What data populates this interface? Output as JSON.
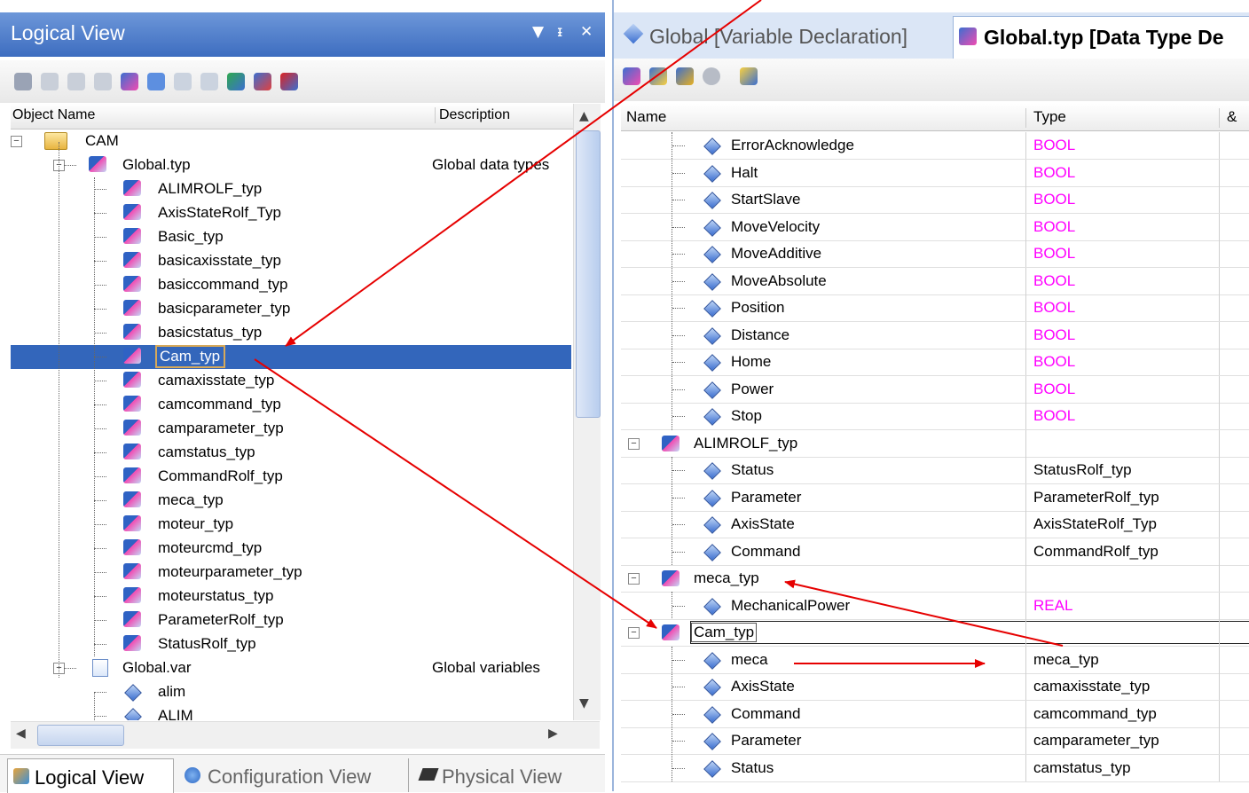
{
  "left_panel": {
    "title": "Logical View",
    "title_controls": [
      "▼",
      "ᵻ",
      "✕"
    ],
    "columns": {
      "object_name": "Object Name",
      "description": "Description"
    },
    "tree": [
      {
        "label": "CAM",
        "desc": "",
        "level": 0,
        "icon": "folder-icon"
      },
      {
        "label": "Global.typ",
        "desc": "Global data types",
        "level": 1,
        "icon": "datatype-icon"
      },
      {
        "label": "ALIMROLF_typ",
        "desc": "",
        "level": 2,
        "icon": "datatype-icon"
      },
      {
        "label": "AxisStateRolf_Typ",
        "desc": "",
        "level": 2,
        "icon": "datatype-icon"
      },
      {
        "label": "Basic_typ",
        "desc": "",
        "level": 2,
        "icon": "datatype-icon"
      },
      {
        "label": "basicaxisstate_typ",
        "desc": "",
        "level": 2,
        "icon": "datatype-icon"
      },
      {
        "label": "basiccommand_typ",
        "desc": "",
        "level": 2,
        "icon": "datatype-icon"
      },
      {
        "label": "basicparameter_typ",
        "desc": "",
        "level": 2,
        "icon": "datatype-icon"
      },
      {
        "label": "basicstatus_typ",
        "desc": "",
        "level": 2,
        "icon": "datatype-icon"
      },
      {
        "label": "Cam_typ",
        "desc": "",
        "level": 2,
        "icon": "datatype-icon",
        "selected": true
      },
      {
        "label": "camaxisstate_typ",
        "desc": "",
        "level": 2,
        "icon": "datatype-icon"
      },
      {
        "label": "camcommand_typ",
        "desc": "",
        "level": 2,
        "icon": "datatype-icon"
      },
      {
        "label": "camparameter_typ",
        "desc": "",
        "level": 2,
        "icon": "datatype-icon"
      },
      {
        "label": "camstatus_typ",
        "desc": "",
        "level": 2,
        "icon": "datatype-icon"
      },
      {
        "label": "CommandRolf_typ",
        "desc": "",
        "level": 2,
        "icon": "datatype-icon"
      },
      {
        "label": "meca_typ",
        "desc": "",
        "level": 2,
        "icon": "datatype-icon"
      },
      {
        "label": "moteur_typ",
        "desc": "",
        "level": 2,
        "icon": "datatype-icon"
      },
      {
        "label": "moteurcmd_typ",
        "desc": "",
        "level": 2,
        "icon": "datatype-icon"
      },
      {
        "label": "moteurparameter_typ",
        "desc": "",
        "level": 2,
        "icon": "datatype-icon"
      },
      {
        "label": "moteurstatus_typ",
        "desc": "",
        "level": 2,
        "icon": "datatype-icon"
      },
      {
        "label": "ParameterRolf_typ",
        "desc": "",
        "level": 2,
        "icon": "datatype-icon"
      },
      {
        "label": "StatusRolf_typ",
        "desc": "",
        "level": 2,
        "icon": "datatype-icon"
      },
      {
        "label": "Global.var",
        "desc": "Global variables",
        "level": 1,
        "icon": "variable-file-icon"
      },
      {
        "label": "alim",
        "desc": "",
        "level": 2,
        "icon": "variable-icon"
      },
      {
        "label": "ALIM",
        "desc": "",
        "level": 2,
        "icon": "variable-icon"
      }
    ],
    "bottom_tabs": [
      "Logical View",
      "Configuration View",
      "Physical View"
    ]
  },
  "right_panel": {
    "tabs": [
      "Global [Variable Declaration]",
      "Global.typ [Data Type De"
    ],
    "columns": {
      "name": "Name",
      "type": "Type",
      "extra": "&"
    },
    "rows": [
      {
        "name": "ErrorAcknowledge",
        "type": "BOOL",
        "kind": "member",
        "pink": true
      },
      {
        "name": "Halt",
        "type": "BOOL",
        "kind": "member",
        "pink": true
      },
      {
        "name": "StartSlave",
        "type": "BOOL",
        "kind": "member",
        "pink": true
      },
      {
        "name": "MoveVelocity",
        "type": "BOOL",
        "kind": "member",
        "pink": true
      },
      {
        "name": "MoveAdditive",
        "type": "BOOL",
        "kind": "member",
        "pink": true
      },
      {
        "name": "MoveAbsolute",
        "type": "BOOL",
        "kind": "member",
        "pink": true
      },
      {
        "name": "Position",
        "type": "BOOL",
        "kind": "member",
        "pink": true
      },
      {
        "name": "Distance",
        "type": "BOOL",
        "kind": "member",
        "pink": true
      },
      {
        "name": "Home",
        "type": "BOOL",
        "kind": "member",
        "pink": true
      },
      {
        "name": "Power",
        "type": "BOOL",
        "kind": "member",
        "pink": true
      },
      {
        "name": "Stop",
        "type": "BOOL",
        "kind": "member",
        "pink": true
      },
      {
        "name": "ALIMROLF_typ",
        "type": "",
        "kind": "type"
      },
      {
        "name": "Status",
        "type": "StatusRolf_typ",
        "kind": "member"
      },
      {
        "name": "Parameter",
        "type": "ParameterRolf_typ",
        "kind": "member"
      },
      {
        "name": "AxisState",
        "type": "AxisStateRolf_Typ",
        "kind": "member"
      },
      {
        "name": "Command",
        "type": "CommandRolf_typ",
        "kind": "member"
      },
      {
        "name": "meca_typ",
        "type": "",
        "kind": "type"
      },
      {
        "name": "MechanicalPower",
        "type": "REAL",
        "kind": "member",
        "pink": true
      },
      {
        "name": "Cam_typ",
        "type": "",
        "kind": "type",
        "editing": true
      },
      {
        "name": "meca",
        "type": "meca_typ",
        "kind": "member"
      },
      {
        "name": "AxisState",
        "type": "camaxisstate_typ",
        "kind": "member"
      },
      {
        "name": "Command",
        "type": "camcommand_typ",
        "kind": "member"
      },
      {
        "name": "Parameter",
        "type": "camparameter_typ",
        "kind": "member"
      },
      {
        "name": "Status",
        "type": "camstatus_typ",
        "kind": "member"
      }
    ]
  },
  "colors": {
    "accent": "#3366bb",
    "title_bar": "#4f7fcf",
    "arrow": "#e60000",
    "bool_type": "#ff00ff"
  }
}
